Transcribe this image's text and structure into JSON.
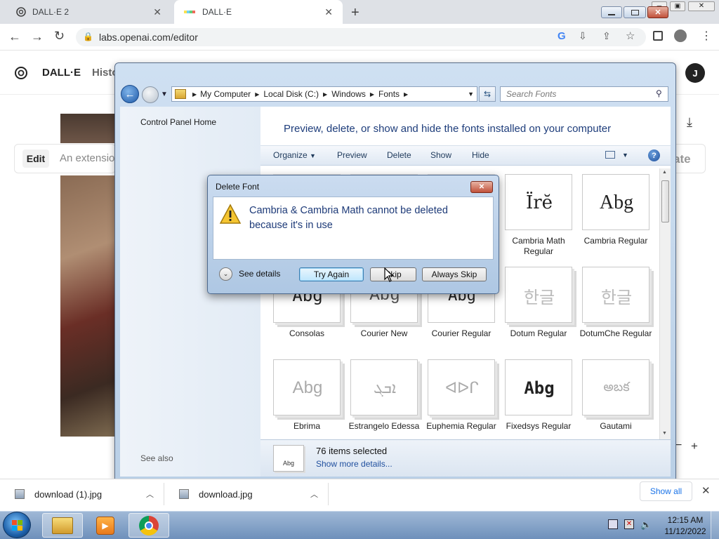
{
  "browser": {
    "tabs": [
      {
        "label": "DALL·E 2"
      },
      {
        "label": "DALL·E"
      }
    ],
    "url": "labs.openai.com/editor"
  },
  "dalle": {
    "logo_text": "DALL·E",
    "nav_partial": "Histo",
    "avatar_letter": "J",
    "edit_label": "Edit",
    "prompt_placeholder": "An extensio",
    "generate_partial": "ate",
    "zoom_minus": "−",
    "zoom_plus": "+"
  },
  "explorer": {
    "breadcrumb": [
      "My Computer",
      "Local Disk (C:)",
      "Windows",
      "Fonts"
    ],
    "search_placeholder": "Search Fonts",
    "nav_home": "Control Panel Home",
    "see_also": "See also",
    "heading": "Preview, delete, or show and hide the fonts installed on your computer",
    "commands": [
      "Organize",
      "Preview",
      "Delete",
      "Show",
      "Hide"
    ],
    "fonts": [
      {
        "name": "Cambria Math Regular",
        "sample": "Ïrĕ"
      },
      {
        "name": "Cambria Regular",
        "sample": "Abg"
      },
      {
        "name": "Consolas",
        "sample": "Abg"
      },
      {
        "name": "Courier New",
        "sample": "Abg"
      },
      {
        "name": "Courier Regular",
        "sample": "Abg"
      },
      {
        "name": "Dotum Regular",
        "sample": "한글"
      },
      {
        "name": "DotumChe Regular",
        "sample": "한글"
      },
      {
        "name": "Ebrima",
        "sample": "Abg"
      },
      {
        "name": "Estrangelo Edessa Regular",
        "sample": "ܐܒܓ"
      },
      {
        "name": "Euphemia Regular",
        "sample": "ᐊᐅᒋ"
      },
      {
        "name": "Fixedsys Regular",
        "sample": "Abg"
      },
      {
        "name": "Gautami",
        "sample": "అబక"
      }
    ],
    "details": {
      "count": "76 items selected",
      "more": "Show more details...",
      "thumb": "Abg"
    }
  },
  "dialog": {
    "title": "Delete Font",
    "message": "Cambria & Cambria Math cannot be deleted because it's in use",
    "see_details": "See details",
    "buttons": {
      "try_again": "Try Again",
      "skip": "Skip",
      "always_skip": "Always Skip"
    }
  },
  "downloads": {
    "items": [
      {
        "name": "download (1).jpg"
      },
      {
        "name": "download.jpg"
      }
    ],
    "show_all": "Show all"
  },
  "taskbar": {
    "time": "12:15 AM",
    "date": "11/12/2022"
  }
}
